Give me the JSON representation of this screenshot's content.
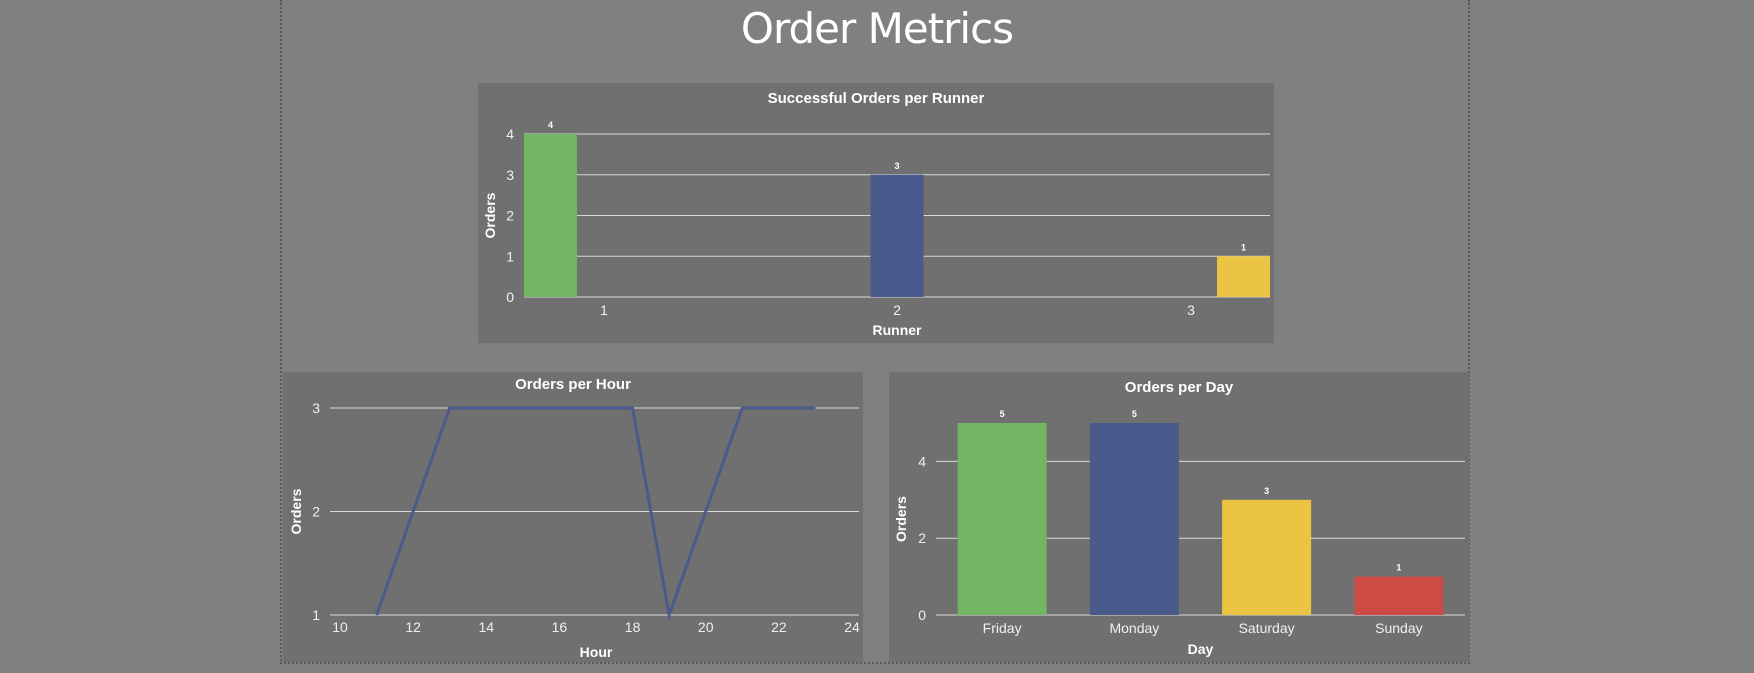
{
  "page": {
    "title": "Order Metrics"
  },
  "colors": {
    "green": "#72b562",
    "blue": "#4a5a8c",
    "yellow": "#ebc443",
    "red": "#cc4b45"
  },
  "chart_data": [
    {
      "id": "runner",
      "type": "bar",
      "title": "Successful Orders per Runner",
      "xlabel": "Runner",
      "ylabel": "Orders",
      "categories": [
        "1",
        "2",
        "3"
      ],
      "values": [
        4,
        3,
        1
      ],
      "data_labels": [
        "4",
        "3",
        "1"
      ],
      "bar_colors": [
        "#72b562",
        "#4a5a8c",
        "#ebc443"
      ],
      "ylim": [
        0,
        4
      ],
      "yticks": [
        0,
        1,
        2,
        3,
        4
      ],
      "grid": true
    },
    {
      "id": "hour",
      "type": "line",
      "title": "Orders per Hour",
      "xlabel": "Hour",
      "ylabel": "Orders",
      "x": [
        11,
        13,
        18,
        19,
        21,
        23
      ],
      "y": [
        1,
        3,
        3,
        1,
        3,
        3
      ],
      "xlim": [
        10,
        24
      ],
      "ylim": [
        1,
        3
      ],
      "xticks": [
        10,
        12,
        14,
        16,
        18,
        20,
        22,
        24
      ],
      "yticks": [
        1,
        2,
        3
      ],
      "line_color": "#4a5a8c",
      "grid": true
    },
    {
      "id": "day",
      "type": "bar",
      "title": "Orders per Day",
      "xlabel": "Day",
      "ylabel": "Orders",
      "categories": [
        "Friday",
        "Monday",
        "Saturday",
        "Sunday"
      ],
      "values": [
        5,
        5,
        3,
        1
      ],
      "data_labels": [
        "5",
        "5",
        "3",
        "1"
      ],
      "bar_colors": [
        "#72b562",
        "#4a5a8c",
        "#ebc443",
        "#cc4b45"
      ],
      "ylim": [
        0,
        5
      ],
      "yticks": [
        0,
        2,
        4
      ],
      "grid": true
    }
  ]
}
